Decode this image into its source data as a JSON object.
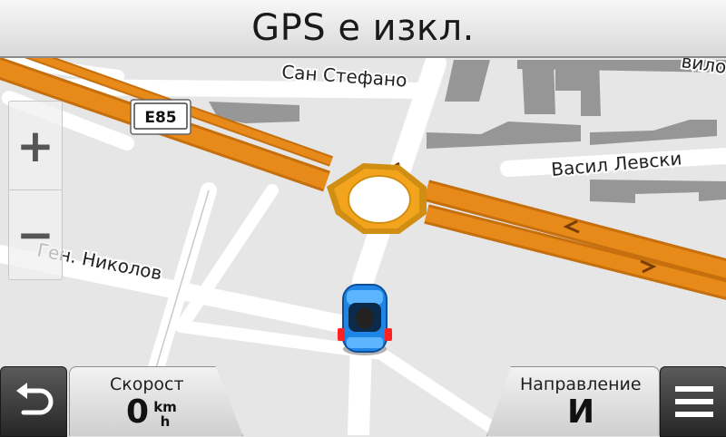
{
  "title": "GPS е изкл.",
  "map": {
    "streets": {
      "san_stefano": "Сан Стефано",
      "vasil_levski": "Васил Левски",
      "gen_nikolov": "Ген. Николов",
      "top_right_partial": "вило"
    },
    "road_badge": "E85"
  },
  "zoom": {
    "in_label": "+",
    "out_label": "−"
  },
  "fields": {
    "speed": {
      "label": "Скорост",
      "value": "0",
      "unit_top": "km",
      "unit_bottom": "h"
    },
    "direction": {
      "label": "Направление",
      "value": "И"
    }
  },
  "icons": {
    "back": "back-arrow-icon",
    "menu": "hamburger-menu-icon",
    "vehicle": "car-vehicle-icon"
  },
  "colors": {
    "primary_road": "#e88a1a",
    "roundabout": "#f2a51c",
    "road": "#ffffff",
    "map_background": "#e6e6e6",
    "building": "#8e8e8e",
    "vehicle": "#1f86e6"
  }
}
